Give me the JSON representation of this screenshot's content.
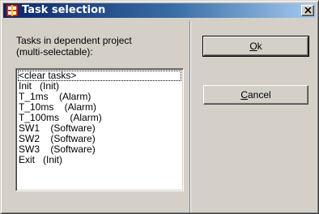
{
  "window": {
    "title": "Task selection",
    "app_icon": "task-grid-icon",
    "close_icon": "close-icon"
  },
  "list": {
    "label_line1": "Tasks in dependent project",
    "label_line2": "(multi-selectable):",
    "items": [
      "<clear tasks>",
      "Init   (Init)",
      "T_1ms    (Alarm)",
      "T_10ms    (Alarm)",
      "T_100ms    (Alarm)",
      "SW1    (Software)",
      "SW2    (Software)",
      "SW3    (Software)",
      "Exit   (Init)"
    ]
  },
  "buttons": {
    "ok_mnemonic": "O",
    "ok_rest": "k",
    "cancel_mnemonic": "C",
    "cancel_rest": "ancel"
  },
  "colors": {
    "titlebar_start": "#0a246a",
    "titlebar_end": "#a6caf0",
    "dialog_face": "#d4d0c8"
  }
}
